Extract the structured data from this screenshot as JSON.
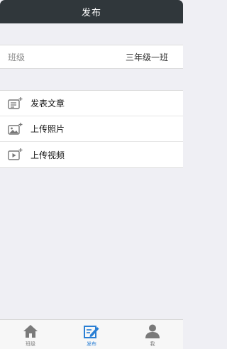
{
  "header": {
    "title": "发布"
  },
  "class_row": {
    "label": "班级",
    "value": "三年级一班"
  },
  "actions": [
    {
      "label": "发表文章",
      "icon": "post-article-icon"
    },
    {
      "label": "上传照片",
      "icon": "upload-photo-icon"
    },
    {
      "label": "上传视频",
      "icon": "upload-video-icon"
    }
  ],
  "tabbar": {
    "tabs": [
      {
        "label": "班级",
        "icon": "home-icon",
        "active": false
      },
      {
        "label": "发布",
        "icon": "edit-icon",
        "active": true
      },
      {
        "label": "我",
        "icon": "user-icon",
        "active": false
      }
    ]
  },
  "colors": {
    "header_bg": "#30373b",
    "background": "#efeff4",
    "active_tab": "#2a7fd4",
    "inactive_tab_icon": "#7a7a7a"
  }
}
